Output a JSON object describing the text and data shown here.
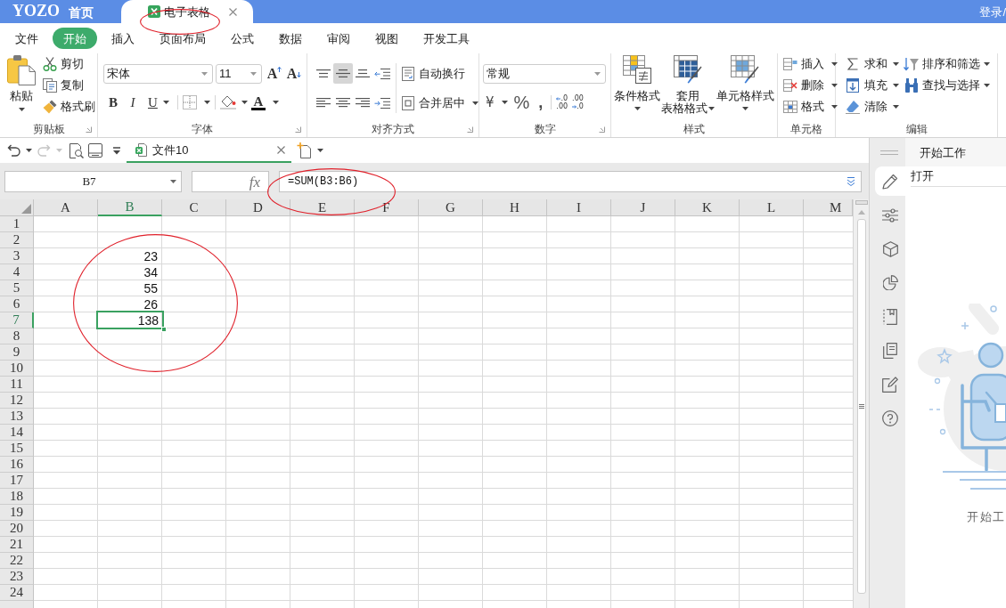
{
  "title_bar": {
    "logo": "YOZO",
    "home": "首页",
    "tabs": [
      {
        "label": "电子表格",
        "selected": true
      }
    ],
    "account": "登录/"
  },
  "menu_tabs": [
    {
      "label": "文件",
      "selected": false
    },
    {
      "label": "开始",
      "selected": true
    },
    {
      "label": "插入",
      "selected": false
    },
    {
      "label": "页面布局",
      "selected": false
    },
    {
      "label": "公式",
      "selected": false
    },
    {
      "label": "数据",
      "selected": false
    },
    {
      "label": "审阅",
      "selected": false
    },
    {
      "label": "视图",
      "selected": false
    },
    {
      "label": "开发工具",
      "selected": false
    }
  ],
  "ribbon": {
    "clipboard": {
      "title": "剪贴板",
      "paste": "粘贴",
      "actions": [
        {
          "kind": "cut",
          "label": "剪切"
        },
        {
          "kind": "copy",
          "label": "复制"
        },
        {
          "kind": "format_painter",
          "label": "格式刷"
        }
      ]
    },
    "font": {
      "title": "字体",
      "font_name": "宋体",
      "font_size": "11",
      "size_buttons": [
        {
          "kind": "grow",
          "glyph": "A"
        },
        {
          "kind": "shrink",
          "glyph": "A"
        }
      ],
      "style_buttons": [
        {
          "kind": "bold",
          "glyph": "B"
        },
        {
          "kind": "italic",
          "glyph": "I"
        },
        {
          "kind": "underline",
          "glyph": "U"
        }
      ],
      "font_color_glyph": "A"
    },
    "alignment": {
      "title": "对齐方式",
      "vertical": [
        {
          "kind": "top",
          "selected": false
        },
        {
          "kind": "middle",
          "selected": true
        },
        {
          "kind": "bottom",
          "selected": false
        }
      ],
      "horizontal": [
        {
          "kind": "left",
          "selected": false
        },
        {
          "kind": "center",
          "selected": false
        },
        {
          "kind": "right",
          "selected": false
        }
      ],
      "wrap": "自动换行",
      "merge": "合并居中"
    },
    "number": {
      "title": "数字",
      "format": "常规",
      "currency": "¥",
      "percent": "%",
      "comma": ",",
      "decimals": [
        {
          "kind": "increase",
          "top": ".0",
          "bottom": ".00"
        },
        {
          "kind": "decrease",
          "top": ".00",
          "bottom": ".0"
        }
      ]
    },
    "styles": {
      "title": "样式",
      "buttons": [
        {
          "kind": "conditional",
          "lines": [
            "条件格式"
          ]
        },
        {
          "kind": "table",
          "lines": [
            "套用",
            "表格格式"
          ]
        },
        {
          "kind": "cell",
          "lines": [
            "单元格样式"
          ]
        }
      ]
    },
    "cells": {
      "title": "单元格",
      "buttons": [
        {
          "kind": "insert",
          "label": "插入"
        },
        {
          "kind": "delete",
          "label": "删除"
        },
        {
          "kind": "format",
          "label": "格式"
        }
      ]
    },
    "editing": {
      "title": "编辑",
      "buttons": [
        {
          "kind": "sum",
          "label": "求和"
        },
        {
          "kind": "fill",
          "label": "填充"
        },
        {
          "kind": "clear",
          "label": "清除"
        },
        {
          "kind": "sort",
          "label": "排序和筛选"
        },
        {
          "kind": "find",
          "label": "查找与选择"
        }
      ]
    }
  },
  "history": [
    {
      "kind": "undo",
      "disabled": false
    },
    {
      "kind": "redo",
      "disabled": true
    }
  ],
  "documents": [
    {
      "label": "文件10",
      "selected": true
    }
  ],
  "formula_bar": {
    "cell": "B7",
    "fx": "fx",
    "formula": "=SUM(B3:B6)"
  },
  "sheet": {
    "columns": [
      {
        "label": "A",
        "selected": false
      },
      {
        "label": "B",
        "selected": true
      },
      {
        "label": "C",
        "selected": false
      },
      {
        "label": "D",
        "selected": false
      },
      {
        "label": "E",
        "selected": false
      },
      {
        "label": "F",
        "selected": false
      },
      {
        "label": "G",
        "selected": false
      },
      {
        "label": "H",
        "selected": false
      },
      {
        "label": "I",
        "selected": false
      },
      {
        "label": "J",
        "selected": false
      },
      {
        "label": "K",
        "selected": false
      },
      {
        "label": "L",
        "selected": false
      },
      {
        "label": "M",
        "selected": false
      }
    ],
    "rows": [
      {
        "label": "1",
        "selected": false
      },
      {
        "label": "2",
        "selected": false
      },
      {
        "label": "3",
        "selected": false,
        "column_b": "23"
      },
      {
        "label": "4",
        "selected": false,
        "column_b": "34"
      },
      {
        "label": "5",
        "selected": false,
        "column_b": "55"
      },
      {
        "label": "6",
        "selected": false,
        "column_b": "26"
      },
      {
        "label": "7",
        "selected": true,
        "column_b": "138"
      },
      {
        "label": "8",
        "selected": false
      },
      {
        "label": "9",
        "selected": false
      },
      {
        "label": "10",
        "selected": false
      },
      {
        "label": "11",
        "selected": false
      },
      {
        "label": "12",
        "selected": false
      },
      {
        "label": "13",
        "selected": false
      },
      {
        "label": "14",
        "selected": false
      },
      {
        "label": "15",
        "selected": false
      },
      {
        "label": "16",
        "selected": false
      },
      {
        "label": "17",
        "selected": false
      },
      {
        "label": "18",
        "selected": false
      },
      {
        "label": "19",
        "selected": false
      },
      {
        "label": "20",
        "selected": false
      },
      {
        "label": "21",
        "selected": false
      },
      {
        "label": "22",
        "selected": false
      },
      {
        "label": "23",
        "selected": false
      },
      {
        "label": "24",
        "selected": false
      }
    ]
  },
  "task_pane": {
    "title": "开始工作",
    "tabs": [
      {
        "kind": "pencil",
        "selected": true
      },
      {
        "kind": "sliders",
        "selected": false
      },
      {
        "kind": "cube",
        "selected": false
      },
      {
        "kind": "pie",
        "selected": false
      },
      {
        "kind": "bookmark",
        "selected": false
      },
      {
        "kind": "copy",
        "selected": false
      },
      {
        "kind": "edit",
        "selected": false
      },
      {
        "kind": "help",
        "selected": false
      }
    ],
    "section": "打开",
    "caption": "开始工"
  }
}
